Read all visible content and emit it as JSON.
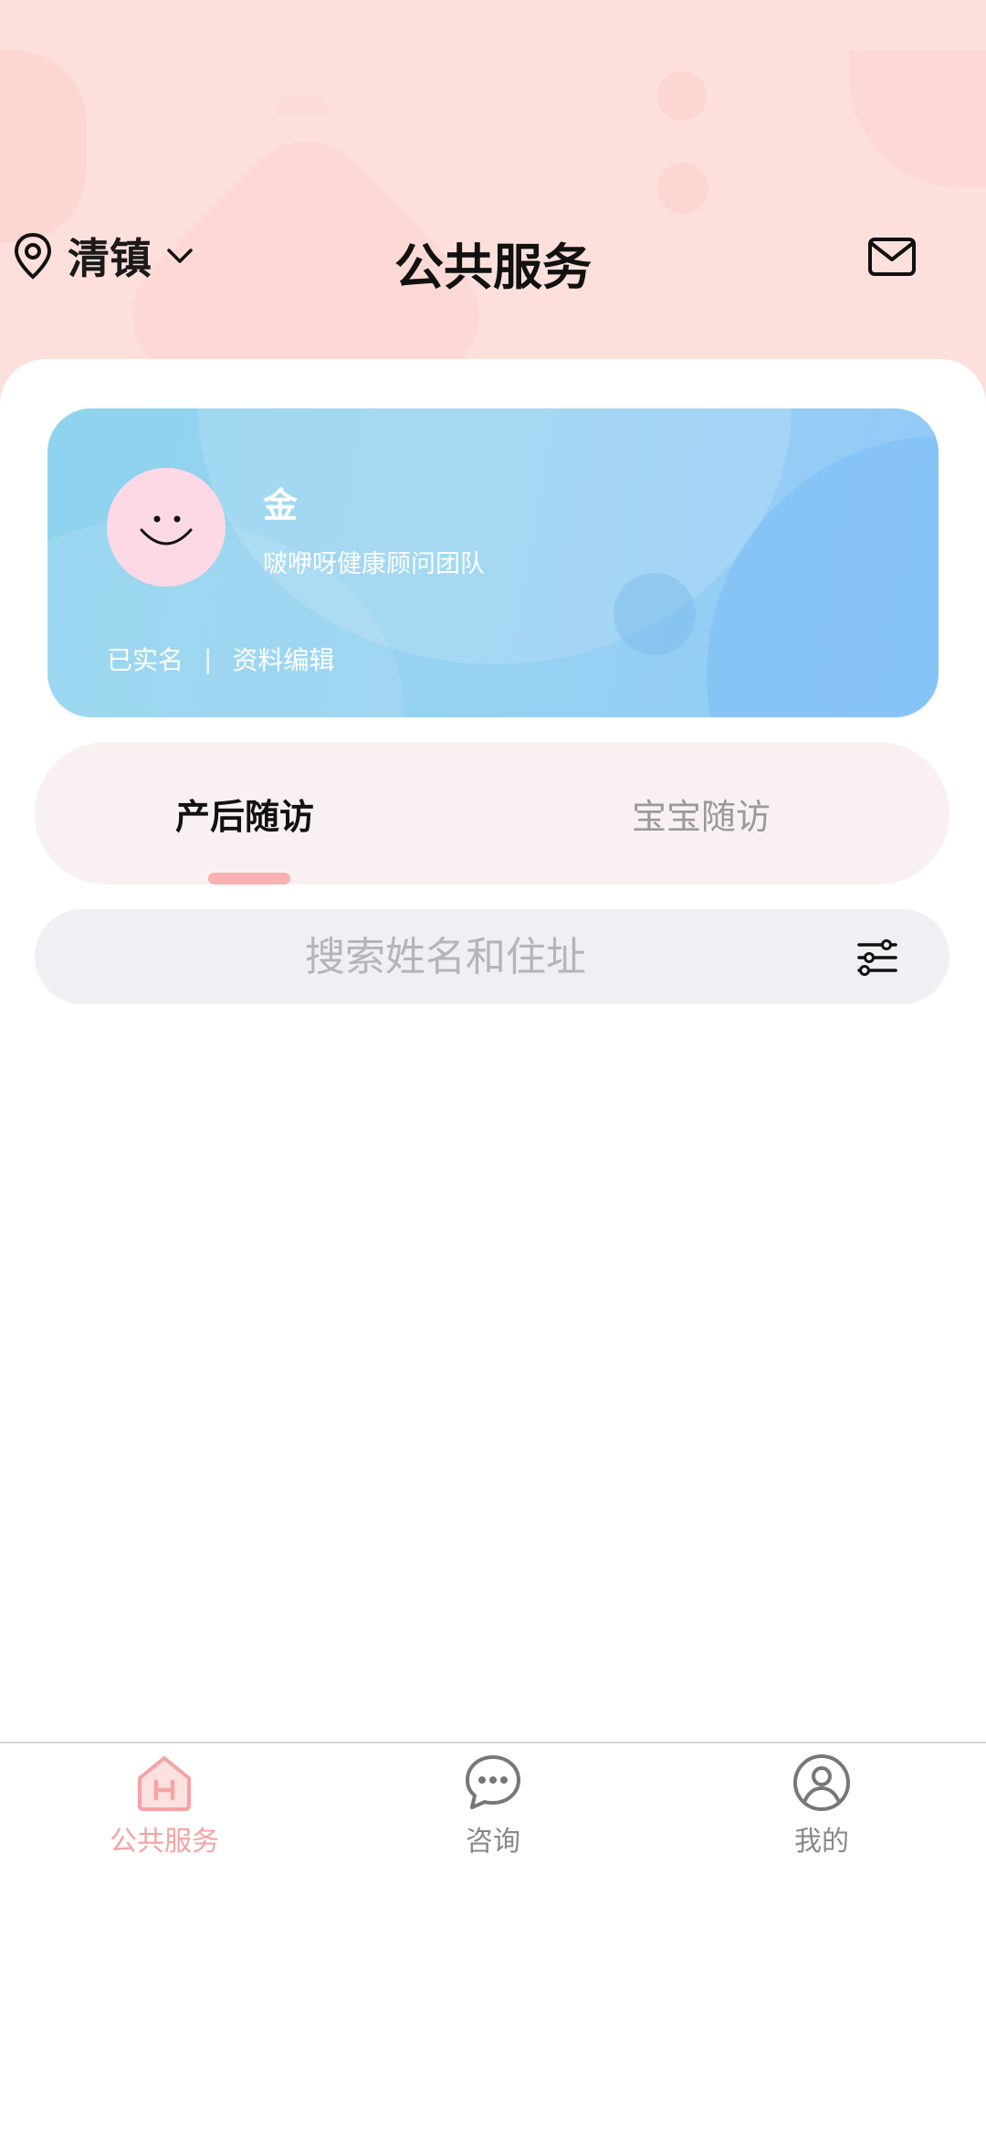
{
  "header": {
    "location": "清镇",
    "title": "公共服务"
  },
  "profile": {
    "name": "金",
    "team": "啵咿呀健康顾问团队",
    "verified_label": "已实名",
    "separator": "|",
    "edit_label": "资料编辑"
  },
  "tabs": [
    {
      "label": "产后随访",
      "active": true
    },
    {
      "label": "宝宝随访",
      "active": false
    }
  ],
  "search": {
    "placeholder": "搜索姓名和住址",
    "value": ""
  },
  "bottom_nav": [
    {
      "label": "公共服务",
      "icon": "house-h-icon",
      "active": true
    },
    {
      "label": "咨询",
      "icon": "chat-bubble-icon",
      "active": false
    },
    {
      "label": "我的",
      "icon": "user-circle-icon",
      "active": false
    }
  ],
  "colors": {
    "header_bg": "#fde0dc",
    "accent_pink": "#f5a3a3",
    "card_blue": "#93cff2"
  }
}
